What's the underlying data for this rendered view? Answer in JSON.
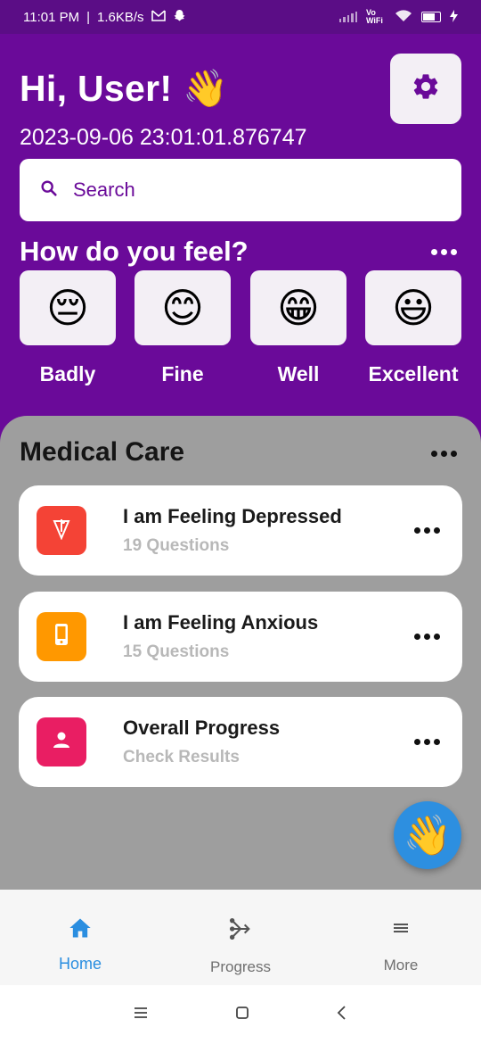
{
  "status_bar": {
    "time": "11:01 PM",
    "network_speed": "1.6KB/s",
    "vowifi": "Vo WiFi"
  },
  "header": {
    "greeting": "Hi, User! 👋",
    "timestamp": "2023-09-06 23:01:01.876747"
  },
  "search": {
    "placeholder": "Search"
  },
  "feelings": {
    "title": "How do you feel?",
    "options": [
      {
        "emoji": "😔",
        "label": "Badly"
      },
      {
        "emoji": "😊",
        "label": "Fine"
      },
      {
        "emoji": "😁",
        "label": "Well"
      },
      {
        "emoji": "😃",
        "label": "Excellent"
      }
    ]
  },
  "medical_care": {
    "title": "Medical Care",
    "items": [
      {
        "title": "I am Feeling Depressed",
        "subtitle": "19 Questions",
        "icon": "brain-icon",
        "color": "#f44336"
      },
      {
        "title": "I am Feeling Anxious",
        "subtitle": "15 Questions",
        "icon": "phone-icon",
        "color": "#ff9800"
      },
      {
        "title": "Overall Progress",
        "subtitle": "Check Results",
        "icon": "person-icon",
        "color": "#e91e63"
      }
    ]
  },
  "fab": {
    "emoji": "👋"
  },
  "bottom_nav": {
    "items": [
      {
        "label": "Home",
        "icon": "home-icon",
        "active": true
      },
      {
        "label": "Progress",
        "icon": "progress-icon",
        "active": false
      },
      {
        "label": "More",
        "icon": "menu-icon",
        "active": false
      }
    ]
  },
  "colors": {
    "primary": "#6a0a99",
    "status_bar": "#5b0d86",
    "panel": "#9e9e9e",
    "active_nav": "#2a8ee0"
  }
}
